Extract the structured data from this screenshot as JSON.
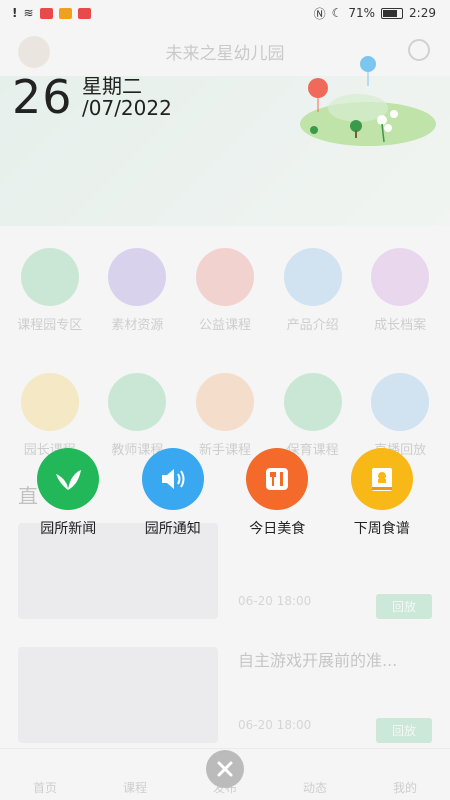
{
  "statusbar": {
    "battery": "71%",
    "time": "2:29"
  },
  "background": {
    "header_title": "未来之星幼儿园",
    "grid": [
      {
        "label": "课程园专区",
        "color": "#39b86a"
      },
      {
        "label": "素材资源",
        "color": "#7a5ad8"
      },
      {
        "label": "公益课程",
        "color": "#ef5a4a"
      },
      {
        "label": "产品介绍",
        "color": "#5aa0e8"
      },
      {
        "label": "成长档案",
        "color": "#c070d8"
      },
      {
        "label": "园长课程",
        "color": "#f4c020"
      },
      {
        "label": "教师课程",
        "color": "#39b86a"
      },
      {
        "label": "新手课程",
        "color": "#f48a3a"
      },
      {
        "label": "保育课程",
        "color": "#39b86a"
      },
      {
        "label": "直播回放",
        "color": "#5aa0e8"
      }
    ],
    "section_title": "直",
    "cards": [
      {
        "title": "",
        "date": "06-20 18:00",
        "action": "回放"
      },
      {
        "title": "自主游戏开展前的准...",
        "date": "06-20 18:00",
        "action": "回放"
      }
    ],
    "tabs": [
      "首页",
      "课程",
      "发布",
      "动态",
      "我的"
    ]
  },
  "date": {
    "day": "26",
    "weekday": "星期二",
    "month_year": "/07/2022"
  },
  "menu": [
    {
      "label": "园所新闻",
      "icon": "leaf-icon",
      "color": "#22b85a"
    },
    {
      "label": "园所通知",
      "icon": "speaker-icon",
      "color": "#3aa8f0"
    },
    {
      "label": "今日美食",
      "icon": "utensils-icon",
      "color": "#f46a2a"
    },
    {
      "label": "下周食谱",
      "icon": "recipe-book-icon",
      "color": "#f8b818"
    }
  ]
}
